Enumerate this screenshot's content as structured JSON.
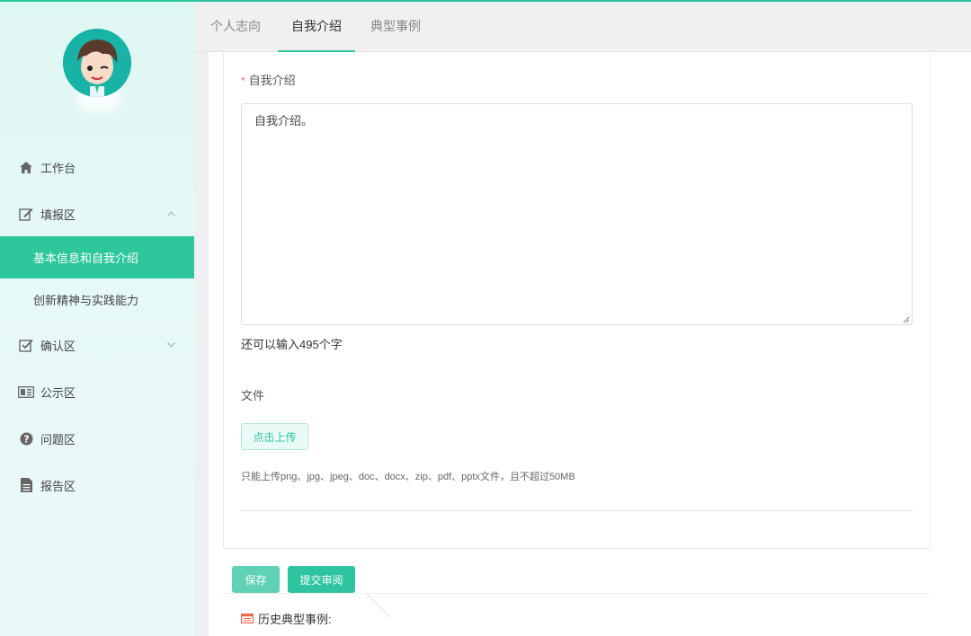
{
  "tabs": [
    {
      "label": "个人志向",
      "active": false
    },
    {
      "label": "自我介绍",
      "active": true
    },
    {
      "label": "典型事例",
      "active": false
    }
  ],
  "sidebar": {
    "items": [
      {
        "label": "工作台",
        "icon": "home-icon"
      },
      {
        "label": "填报区",
        "icon": "edit-icon",
        "expanded": true
      },
      {
        "label": "基本信息和自我介绍",
        "sub": true,
        "active": true
      },
      {
        "label": "创新精神与实践能力",
        "sub": true,
        "active": false
      },
      {
        "label": "确认区",
        "icon": "check-square-icon",
        "expanded": false
      },
      {
        "label": "公示区",
        "icon": "newspaper-icon"
      },
      {
        "label": "问题区",
        "icon": "question-circle-icon"
      },
      {
        "label": "报告区",
        "icon": "document-icon"
      }
    ]
  },
  "form": {
    "intro_label": "自我介绍",
    "intro_required_mark": "*",
    "intro_value": "自我介绍。",
    "counter_text": "还可以输入495个字",
    "file_label": "文件",
    "upload_label": "点击上传",
    "upload_hint": "只能上传png、jpg、jpeg、doc、docx、zip、pdf、pptx文件，且不超过50MB"
  },
  "actions": {
    "save_label": "保存",
    "submit_label": "提交审阅"
  },
  "history": {
    "title": "历史典型事例:"
  },
  "colors": {
    "accent": "#2ec4a0",
    "active_menu": "#2ec69b",
    "required": "#f56c6c"
  }
}
